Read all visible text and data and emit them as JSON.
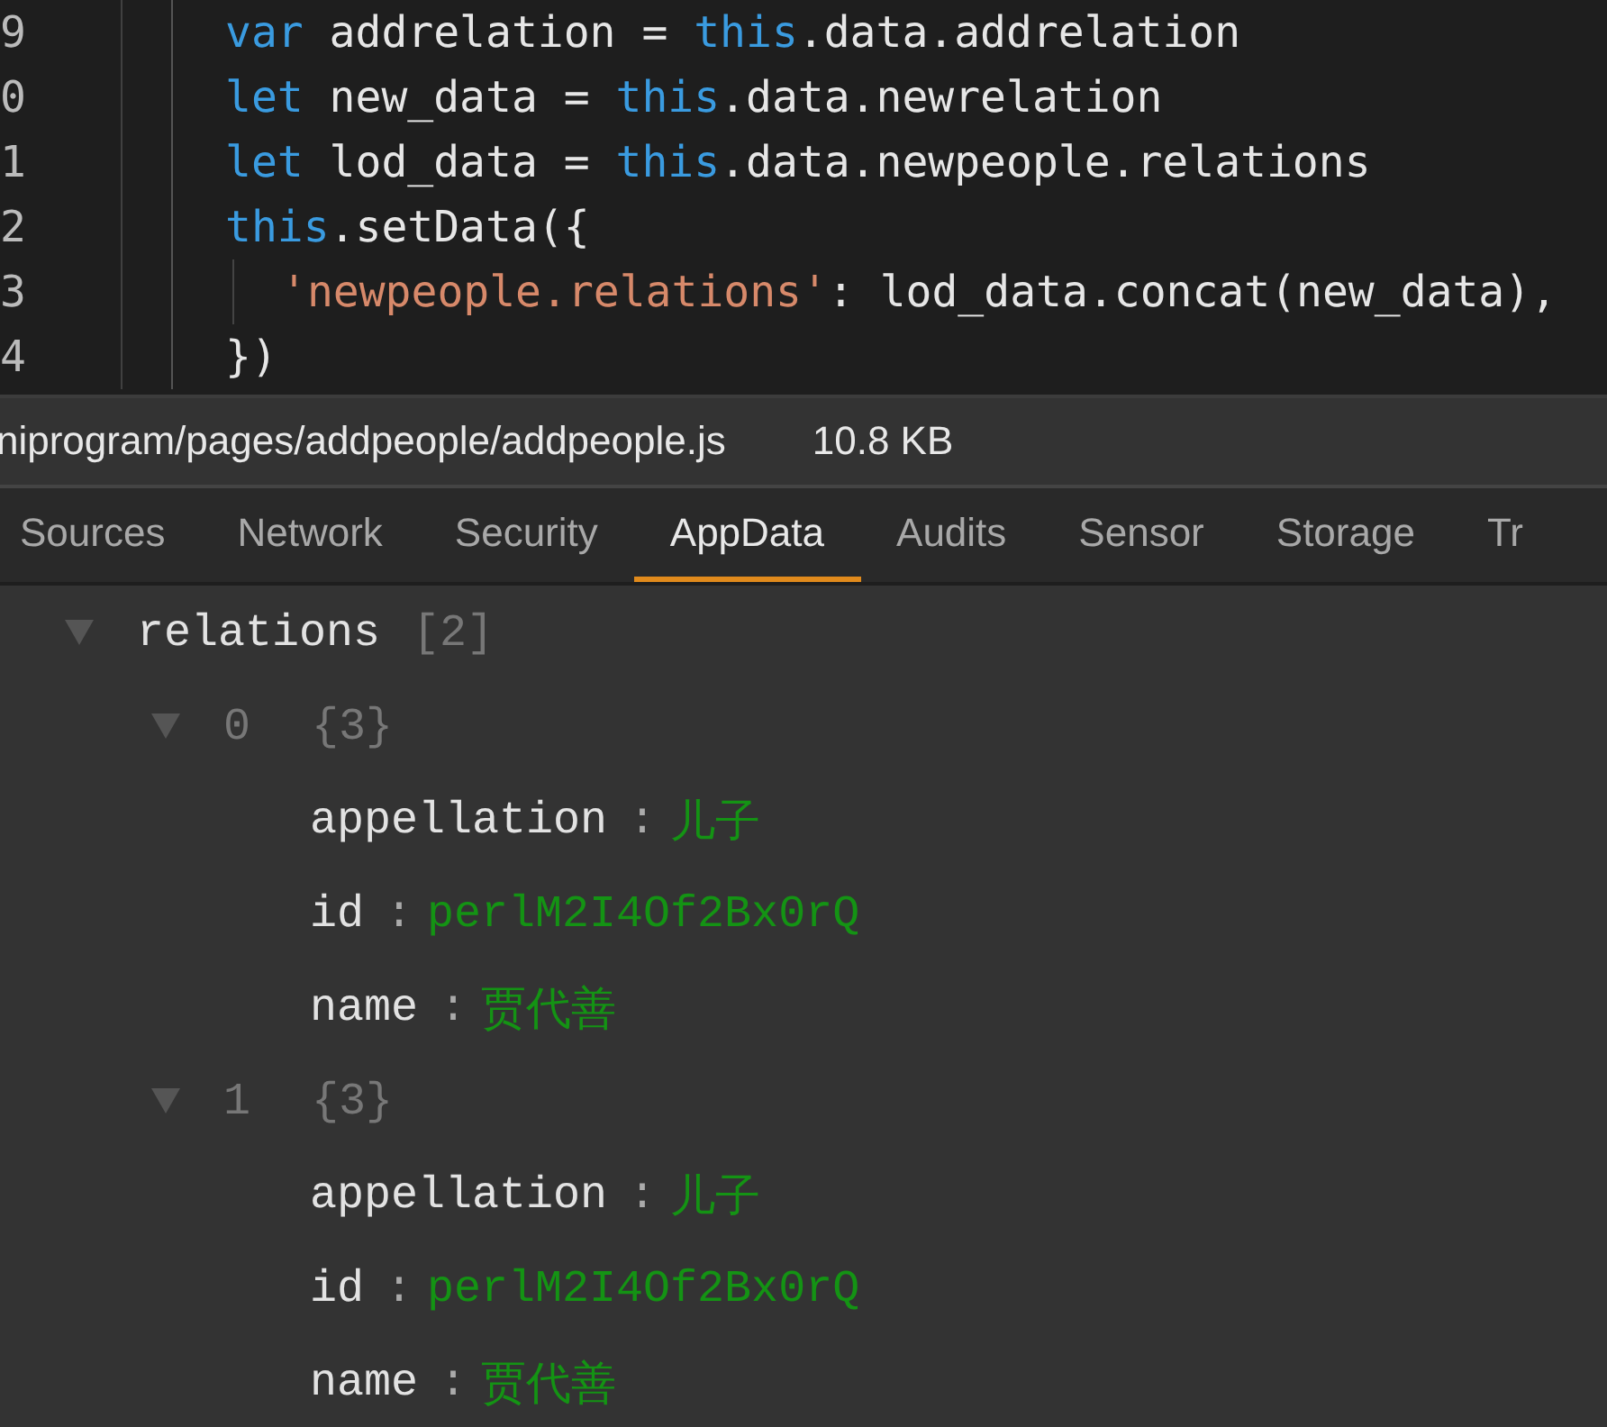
{
  "editor": {
    "lines": [
      {
        "number": "9",
        "tokens": [
          {
            "text": "var",
            "kind": "keyword"
          },
          {
            "text": " addrelation = ",
            "kind": "plain"
          },
          {
            "text": "this",
            "kind": "keyword"
          },
          {
            "text": ".data.addrelation",
            "kind": "plain"
          }
        ]
      },
      {
        "number": "0",
        "tokens": [
          {
            "text": "let",
            "kind": "keyword"
          },
          {
            "text": " new_data = ",
            "kind": "plain"
          },
          {
            "text": "this",
            "kind": "keyword"
          },
          {
            "text": ".data.newrelation",
            "kind": "plain"
          }
        ]
      },
      {
        "number": "1",
        "tokens": [
          {
            "text": "let",
            "kind": "keyword"
          },
          {
            "text": " lod_data = ",
            "kind": "plain"
          },
          {
            "text": "this",
            "kind": "keyword"
          },
          {
            "text": ".data.newpeople.relations",
            "kind": "plain"
          }
        ]
      },
      {
        "number": "2",
        "tokens": [
          {
            "text": "this",
            "kind": "keyword"
          },
          {
            "text": ".setData({",
            "kind": "plain"
          }
        ],
        "children": [
          {
            "number": "3",
            "tokens": [
              {
                "text": "'newpeople.relations'",
                "kind": "string"
              },
              {
                "text": ": lod_data.concat(new_data),",
                "kind": "plain"
              }
            ]
          }
        ]
      },
      {
        "number": "4",
        "tokens": [
          {
            "text": "})",
            "kind": "plain"
          }
        ]
      }
    ]
  },
  "file_bar": {
    "path": "niprogram/pages/addpeople/addpeople.js",
    "size": "10.8 KB"
  },
  "tabs": [
    {
      "label": "Sources",
      "selected": false
    },
    {
      "label": "Network",
      "selected": false
    },
    {
      "label": "Security",
      "selected": false
    },
    {
      "label": "AppData",
      "selected": true
    },
    {
      "label": "Audits",
      "selected": false
    },
    {
      "label": "Sensor",
      "selected": false
    },
    {
      "label": "Storage",
      "selected": false
    },
    {
      "label": "Tr",
      "selected": false
    }
  ],
  "tree": {
    "key": "relations",
    "summary": "[2]",
    "expanded": true,
    "children": [
      {
        "index": "0",
        "summary": "{3}",
        "expanded": true,
        "fields": [
          {
            "key": "appellation",
            "separator": ":",
            "value": "儿子"
          },
          {
            "key": "id",
            "separator": ":",
            "value": "perlM2I4Of2Bx0rQ"
          },
          {
            "key": "name",
            "separator": ":",
            "value": "贾代善"
          }
        ]
      },
      {
        "index": "1",
        "summary": "{3}",
        "expanded": true,
        "fields": [
          {
            "key": "appellation",
            "separator": ":",
            "value": "儿子"
          },
          {
            "key": "id",
            "separator": ":",
            "value": "perlM2I4Of2Bx0rQ"
          },
          {
            "key": "name",
            "separator": ":",
            "value": "贾代善"
          }
        ]
      }
    ]
  }
}
